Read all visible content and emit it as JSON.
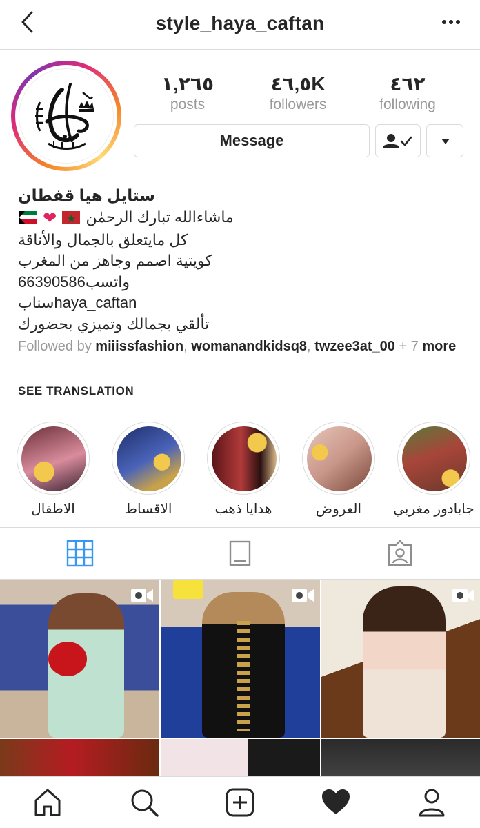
{
  "header": {
    "username": "style_haya_caftan"
  },
  "stats": [
    {
      "value": "١,٢٦٥",
      "label": "posts"
    },
    {
      "value": "٤٦,٥K",
      "label": "followers"
    },
    {
      "value": "٤٦٢",
      "label": "following"
    }
  ],
  "actions": {
    "message_label": "Message"
  },
  "bio": {
    "name": "ستايل هيا قفطان",
    "line1": "ماشاءالله تبارك الرحمٰن",
    "line2": "كل مايتعلق بالجمال والأناقة",
    "line3": "كويتية اصمم وجاهز من المغرب",
    "line4": "واتسب66390586",
    "line5": "سنابhaya_caftan",
    "line6": "تألقي بجمالك وتميزي بحضورك"
  },
  "followed_by": {
    "prefix": "Followed by",
    "users": [
      "miiissfashion",
      "womanandkidsq8",
      "twzee3at_00"
    ],
    "sep": ",",
    "more": "+ 7",
    "more_word": "more"
  },
  "see_translation": "SEE TRANSLATION",
  "highlights": [
    {
      "label": "الاطفال"
    },
    {
      "label": "الاقساط"
    },
    {
      "label": "هدايا ذهب"
    },
    {
      "label": "العروض"
    },
    {
      "label": "جابادور مغربي"
    }
  ],
  "tabs": [
    "grid",
    "igtv",
    "tagged"
  ],
  "colors": {
    "text": "#262626",
    "muted": "#999999",
    "accent": "#3897f0",
    "border": "#dbdbdb"
  },
  "icons": [
    "back-chevron-icon",
    "more-dots-icon",
    "person-check-icon",
    "caret-down-icon",
    "grid-icon",
    "igtv-icon",
    "tagged-icon",
    "video-icon",
    "home-icon",
    "search-icon",
    "add-icon",
    "heart-icon",
    "profile-icon"
  ]
}
